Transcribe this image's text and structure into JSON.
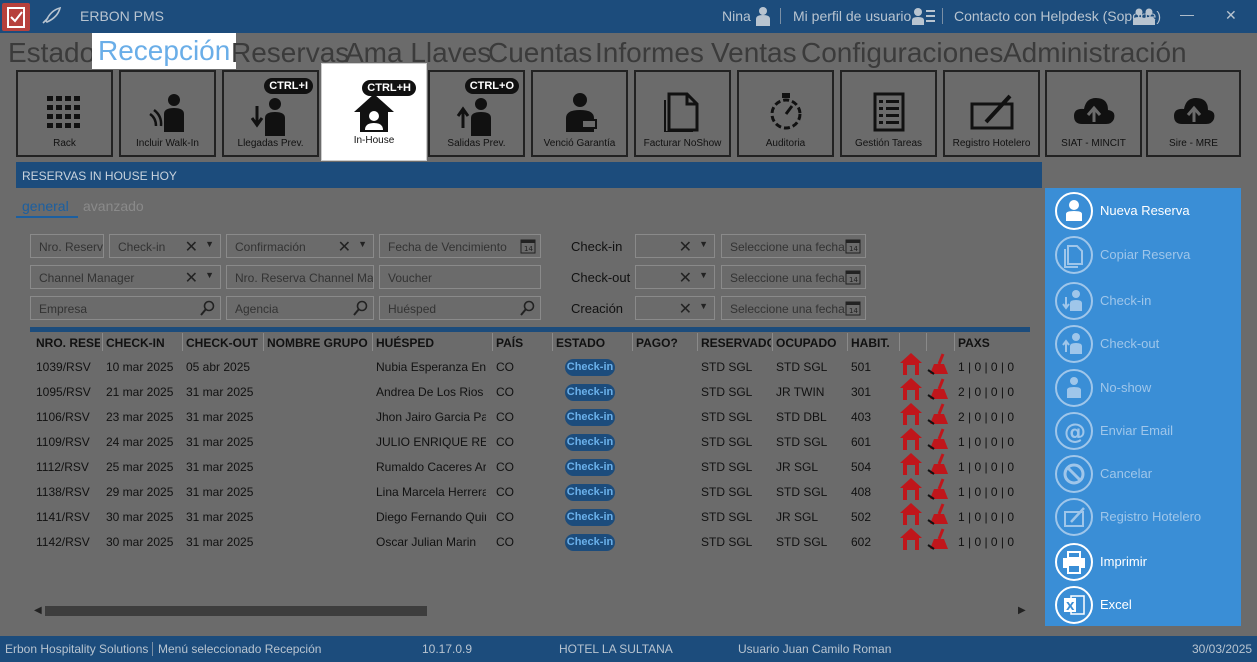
{
  "titlebar": {
    "app_name": "ERBON PMS",
    "user_name": "Nina",
    "profile_link": "Mi perfil de usuario",
    "helpdesk_link": "Contacto con Helpdesk (Soporte)",
    "minimize_glyph": "—",
    "close_glyph": "✕"
  },
  "menu": [
    {
      "label": "Estado",
      "active": false
    },
    {
      "label": "Recepción",
      "active": true
    },
    {
      "label": "Reservas",
      "active": false
    },
    {
      "label": "Ama Llaves",
      "active": false
    },
    {
      "label": "Cuentas",
      "active": false
    },
    {
      "label": "Informes",
      "active": false
    },
    {
      "label": "Ventas",
      "active": false
    },
    {
      "label": "Configuraciones",
      "active": false
    },
    {
      "label": "Administración",
      "active": false
    }
  ],
  "toolbar": [
    {
      "label": "Rack",
      "icon": "grid-icon",
      "shortcut": ""
    },
    {
      "label": "Incluir Walk-In",
      "icon": "walk-in-icon",
      "shortcut": ""
    },
    {
      "label": "Llegadas Prev.",
      "icon": "arrival-icon",
      "shortcut": "CTRL+I"
    },
    {
      "label": "In-House",
      "icon": "house-person-icon",
      "shortcut": "CTRL+H",
      "active": true
    },
    {
      "label": "Salidas Prev.",
      "icon": "departure-icon",
      "shortcut": "CTRL+O"
    },
    {
      "label": "Venció Garantía",
      "icon": "guarantee-icon",
      "shortcut": ""
    },
    {
      "label": "Facturar NoShow",
      "icon": "document-icon",
      "shortcut": ""
    },
    {
      "label": "Auditoria",
      "icon": "timer-icon",
      "shortcut": ""
    },
    {
      "label": "Gestión Tareas",
      "icon": "task-list-icon",
      "shortcut": ""
    },
    {
      "label": "Registro Hotelero",
      "icon": "edit-box-icon",
      "shortcut": ""
    },
    {
      "label": "SIAT - MINCIT",
      "icon": "cloud-upload-icon",
      "shortcut": ""
    },
    {
      "label": "Sire - MRE",
      "icon": "cloud-upload-icon",
      "shortcut": ""
    }
  ],
  "section_title": "RESERVAS IN HOUSE HOY",
  "subtabs": {
    "general": "general",
    "advanced": "avanzado"
  },
  "filters": {
    "nro_reserva": "Nro. Reserva",
    "checkin": "Check-in",
    "confirmacion": "Confirmación",
    "fecha_vencimiento": "Fecha de Vencimiento",
    "channel_manager": "Channel Manager",
    "nro_reserva_channel": "Nro. Reserva Channel Manager",
    "voucher": "Voucher",
    "empresa": "Empresa",
    "agencia": "Agencia",
    "huesped": "Huésped",
    "label_checkin": "Check-in",
    "label_checkout": "Check-out",
    "label_creacion": "Creación",
    "date_placeholder": "Seleccione una fecha"
  },
  "table": {
    "headers": [
      "NRO. RESERVA",
      "CHECK-IN",
      "CHECK-OUT",
      "NOMBRE GRUPO",
      "HUÉSPED",
      "PAÍS",
      "ESTADO",
      "PAGO?",
      "RESERVADO",
      "OCUPADO",
      "HABIT.",
      "",
      "",
      "PAXS"
    ],
    "rows": [
      {
        "nro": "1039/RSV",
        "checkin": "10 mar 2025",
        "checkout": "05 abr 2025",
        "grupo": "",
        "huesped": "Nubia Esperanza Enriquez",
        "pais": "CO",
        "estado": "Check-in",
        "pago": "",
        "reservado": "STD SGL",
        "ocupado": "STD SGL",
        "habit": "501",
        "paxs": "1 | 0 | 0 | 0"
      },
      {
        "nro": "1095/RSV",
        "checkin": "21 mar 2025",
        "checkout": "31 mar 2025",
        "grupo": "",
        "huesped": "Andrea De Los Rios",
        "pais": "CO",
        "estado": "Check-in",
        "pago": "",
        "reservado": "STD SGL",
        "ocupado": "JR TWIN",
        "habit": "301",
        "paxs": "2 | 0 | 0 | 0"
      },
      {
        "nro": "1106/RSV",
        "checkin": "23 mar 2025",
        "checkout": "31 mar 2025",
        "grupo": "",
        "huesped": "Jhon Jairo Garcia Parra",
        "pais": "CO",
        "estado": "Check-in",
        "pago": "",
        "reservado": "STD SGL",
        "ocupado": "STD DBL",
        "habit": "403",
        "paxs": "2 | 0 | 0 | 0"
      },
      {
        "nro": "1109/RSV",
        "checkin": "24 mar 2025",
        "checkout": "31 mar 2025",
        "grupo": "",
        "huesped": "JULIO ENRIQUE REYES",
        "pais": "CO",
        "estado": "Check-in",
        "pago": "",
        "reservado": "STD SGL",
        "ocupado": "STD SGL",
        "habit": "601",
        "paxs": "1 | 0 | 0 | 0"
      },
      {
        "nro": "1112/RSV",
        "checkin": "25 mar 2025",
        "checkout": "31 mar 2025",
        "grupo": "",
        "huesped": "Rumaldo Caceres Arias",
        "pais": "CO",
        "estado": "Check-in",
        "pago": "",
        "reservado": "STD SGL",
        "ocupado": "JR SGL",
        "habit": "504",
        "paxs": "1 | 0 | 0 | 0"
      },
      {
        "nro": "1138/RSV",
        "checkin": "29 mar 2025",
        "checkout": "31 mar 2025",
        "grupo": "",
        "huesped": "Lina Marcela Herrera",
        "pais": "CO",
        "estado": "Check-in",
        "pago": "",
        "reservado": "STD SGL",
        "ocupado": "STD SGL",
        "habit": "408",
        "paxs": "1 | 0 | 0 | 0"
      },
      {
        "nro": "1141/RSV",
        "checkin": "30 mar 2025",
        "checkout": "31 mar 2025",
        "grupo": "",
        "huesped": "Diego Fernando Quintero",
        "pais": "CO",
        "estado": "Check-in",
        "pago": "",
        "reservado": "STD SGL",
        "ocupado": "JR SGL",
        "habit": "502",
        "paxs": "1 | 0 | 0 | 0"
      },
      {
        "nro": "1142/RSV",
        "checkin": "30 mar 2025",
        "checkout": "31 mar 2025",
        "grupo": "",
        "huesped": "Oscar Julian Marin",
        "pais": "CO",
        "estado": "Check-in",
        "pago": "",
        "reservado": "STD SGL",
        "ocupado": "STD SGL",
        "habit": "602",
        "paxs": "1 | 0 | 0 | 0"
      }
    ]
  },
  "actions": [
    {
      "label": "Nueva Reserva",
      "icon": "person-icon",
      "enabled": true
    },
    {
      "label": "Copiar Reserva",
      "icon": "copy-icon",
      "enabled": false
    },
    {
      "label": "Check-in",
      "icon": "checkin-icon",
      "enabled": false
    },
    {
      "label": "Check-out",
      "icon": "checkout-icon",
      "enabled": false
    },
    {
      "label": "No-show",
      "icon": "noshow-icon",
      "enabled": false
    },
    {
      "label": "Enviar Email",
      "icon": "at-icon",
      "enabled": false
    },
    {
      "label": "Cancelar",
      "icon": "cancel-icon",
      "enabled": false
    },
    {
      "label": "Registro Hotelero",
      "icon": "edit-box-icon",
      "enabled": false
    },
    {
      "label": "Imprimir",
      "icon": "printer-icon",
      "enabled": true
    },
    {
      "label": "Excel",
      "icon": "excel-icon",
      "enabled": true
    }
  ],
  "statusbar": {
    "company": "Erbon Hospitality Solutions",
    "menu_selected": "Menú seleccionado  Recepción",
    "version": "10.17.0.9",
    "hotel": "HOTEL LA SULTANA",
    "user": "Usuario Juan Camilo Roman",
    "date": "30/03/2025"
  },
  "colors": {
    "brand_dark": "#1c4c7c",
    "accent_blue": "#3a8ed6",
    "alert_red": "#c0161b",
    "overlay_gray": "#6b6b6b"
  }
}
